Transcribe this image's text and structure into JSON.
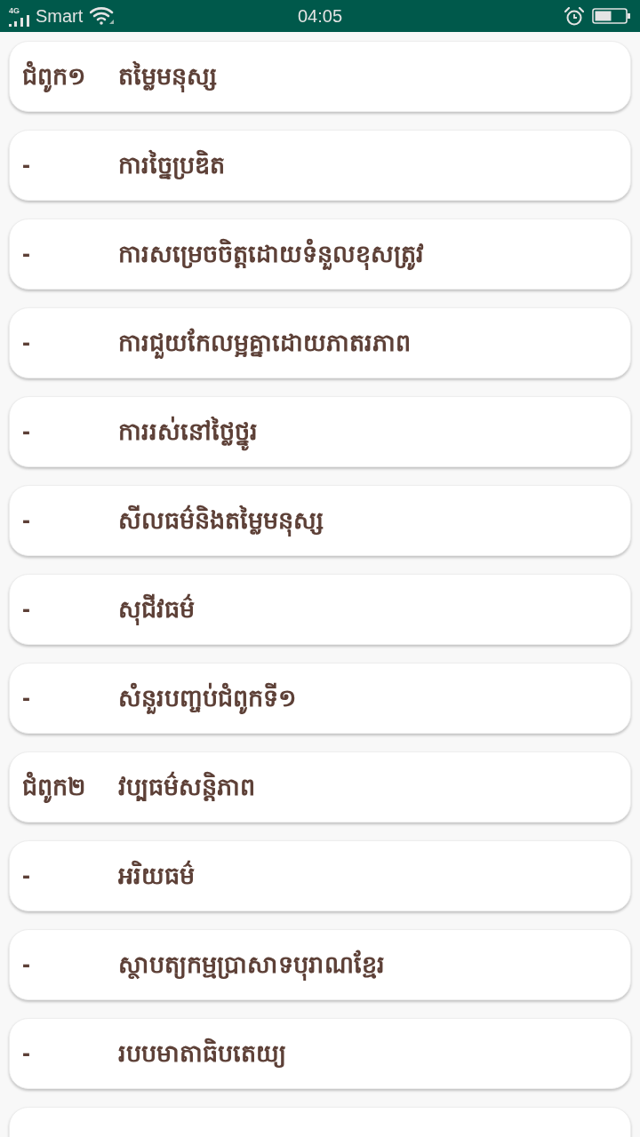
{
  "status_bar": {
    "network": "4G",
    "carrier": "Smart",
    "time": "04:05"
  },
  "items": [
    {
      "marker": "ជំពូក១",
      "title": "តម្លៃមនុស្ស"
    },
    {
      "marker": "-",
      "title": "ការច្នៃប្រឌិត"
    },
    {
      "marker": "-",
      "title": "ការសម្រេចចិត្តដោយទំនួលខុសត្រូវ"
    },
    {
      "marker": "-",
      "title": "ការជួយកែលម្អគ្នាដោយភាតរភាព"
    },
    {
      "marker": "-",
      "title": "ការរស់នៅថ្លៃថ្នូរ"
    },
    {
      "marker": "-",
      "title": "សីលធម៌និងតម្លៃមនុស្ស"
    },
    {
      "marker": "-",
      "title": "សុជីវធម៌"
    },
    {
      "marker": "-",
      "title": "សំនួរបញ្ចប់ជំពូកទី១"
    },
    {
      "marker": "ជំពូក២",
      "title": "វប្បធម៌សន្តិភាព"
    },
    {
      "marker": "-",
      "title": "អរិយធម៌"
    },
    {
      "marker": "-",
      "title": "ស្ថាបត្យកម្មប្រាសាទបុរាណខ្មែរ"
    },
    {
      "marker": "-",
      "title": "របបមាតាធិបតេយ្យ"
    }
  ],
  "list_continues": true
}
